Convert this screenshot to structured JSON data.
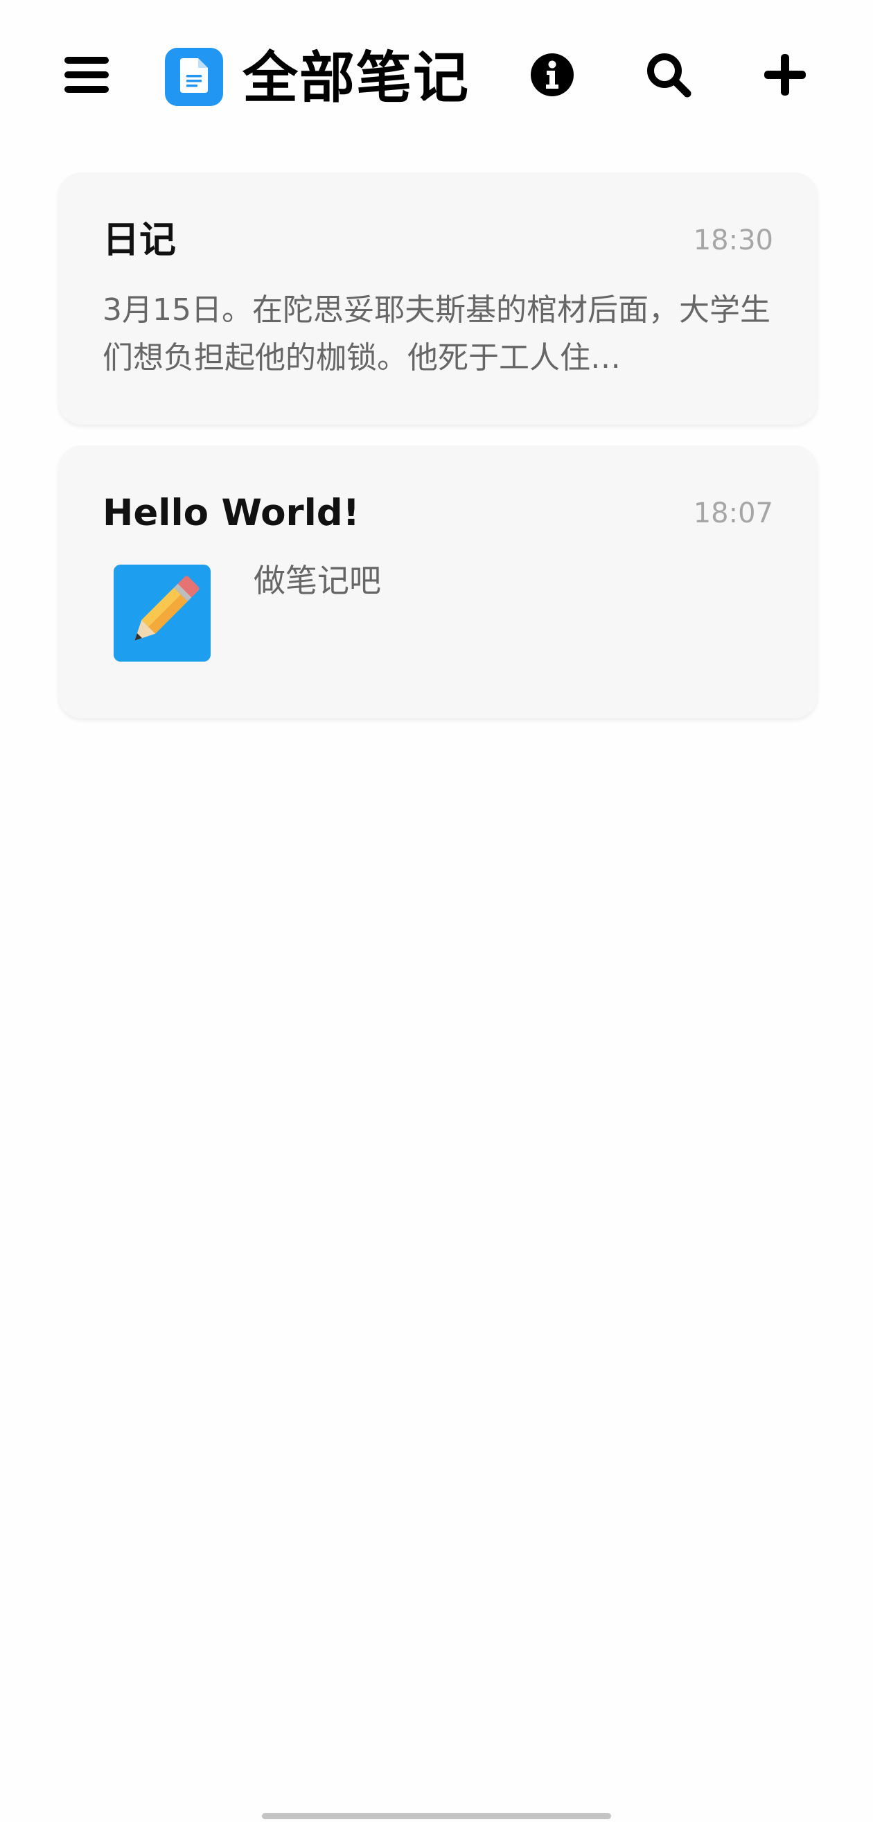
{
  "appbar": {
    "title": "全部笔记",
    "icons": {
      "menu": "menu-icon",
      "logo": "note-document-icon",
      "info": "info-icon",
      "search": "search-icon",
      "add": "plus-icon"
    }
  },
  "notes": [
    {
      "title": "日记",
      "time": "18:30",
      "preview": "3月15日。在陀思妥耶夫斯基的棺材后面，大学生们想负担起他的枷锁。他死于工人住…"
    },
    {
      "title": "Hello World!",
      "time": "18:07",
      "thumbnail_icon": "pencil-icon",
      "preview": "做笔记吧"
    }
  ],
  "colors": {
    "accent": "#2196f3",
    "card_background": "#f7f7f7",
    "time_text": "#a6a6a6",
    "preview_text": "#666666"
  }
}
